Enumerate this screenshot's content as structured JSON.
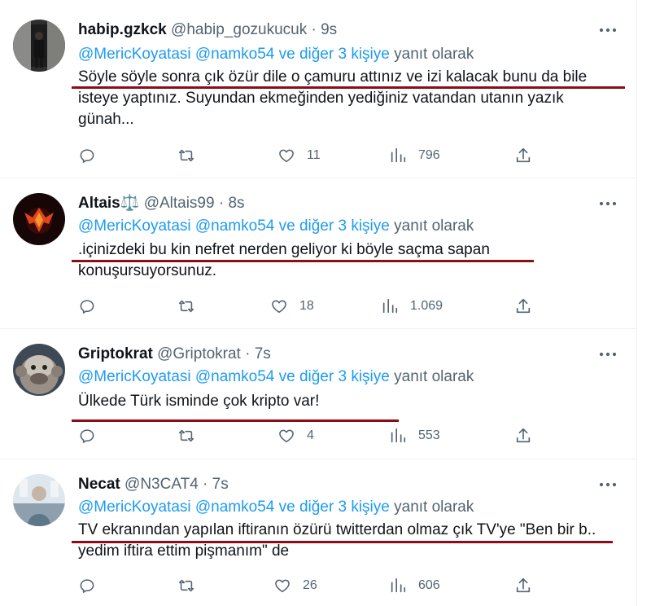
{
  "tweets": [
    {
      "name": "habip.gzkck",
      "handle": "@habip_gozukucuk",
      "dot": "·",
      "time": "9s",
      "mentions": "@MericKoyatasi @namko54  ve diğer 3 kişiye",
      "reply_suffix": "yanıt olarak",
      "text": "Söyle söyle sonra çık özür dile o çamuru attınız ve izi kalacak bunu da bile isteye yaptınız. Suyundan ekmeğinden yediğiniz vatandan utanın yazık günah...",
      "likes": "11",
      "views": "796"
    },
    {
      "name": "Altais⚖️",
      "handle": "@Altais99",
      "dot": "·",
      "time": "8s",
      "mentions": "@MericKoyatasi @namko54  ve diğer 3 kişiye",
      "reply_suffix": "yanıt olarak",
      "text": ".içinizdeki  bu kin nefret nerden geliyor ki böyle saçma sapan konuşursuyorsunuz.",
      "likes": "18",
      "views": "1.069"
    },
    {
      "name": "Griptokrat",
      "handle": "@Griptokrat",
      "dot": "·",
      "time": "7s",
      "mentions": "@MericKoyatasi @namko54  ve diğer 3 kişiye",
      "reply_suffix": "yanıt olarak",
      "text": "Ülkede Türk isminde çok kripto var!",
      "likes": "4",
      "views": "553"
    },
    {
      "name": "Necat",
      "handle": "@N3CAT4",
      "dot": "·",
      "time": "7s",
      "mentions": "@MericKoyatasi @namko54  ve diğer 3 kişiye",
      "reply_suffix": "yanıt olarak",
      "text": "TV ekranından yapılan iftiranın özürü twitterdan olmaz çık TV'ye \"Ben bir b.. yedim iftira ettim pişmanım\" de",
      "likes": "26",
      "views": "606"
    }
  ],
  "icons": {
    "reply": "reply-icon",
    "retweet": "retweet-icon",
    "like": "heart-icon",
    "views": "views-icon",
    "share": "share-icon",
    "more": "more-icon"
  },
  "colors": {
    "link": "#1d9bf0",
    "secondary_text": "#536471",
    "underline_annotation": "#8b0d18"
  }
}
